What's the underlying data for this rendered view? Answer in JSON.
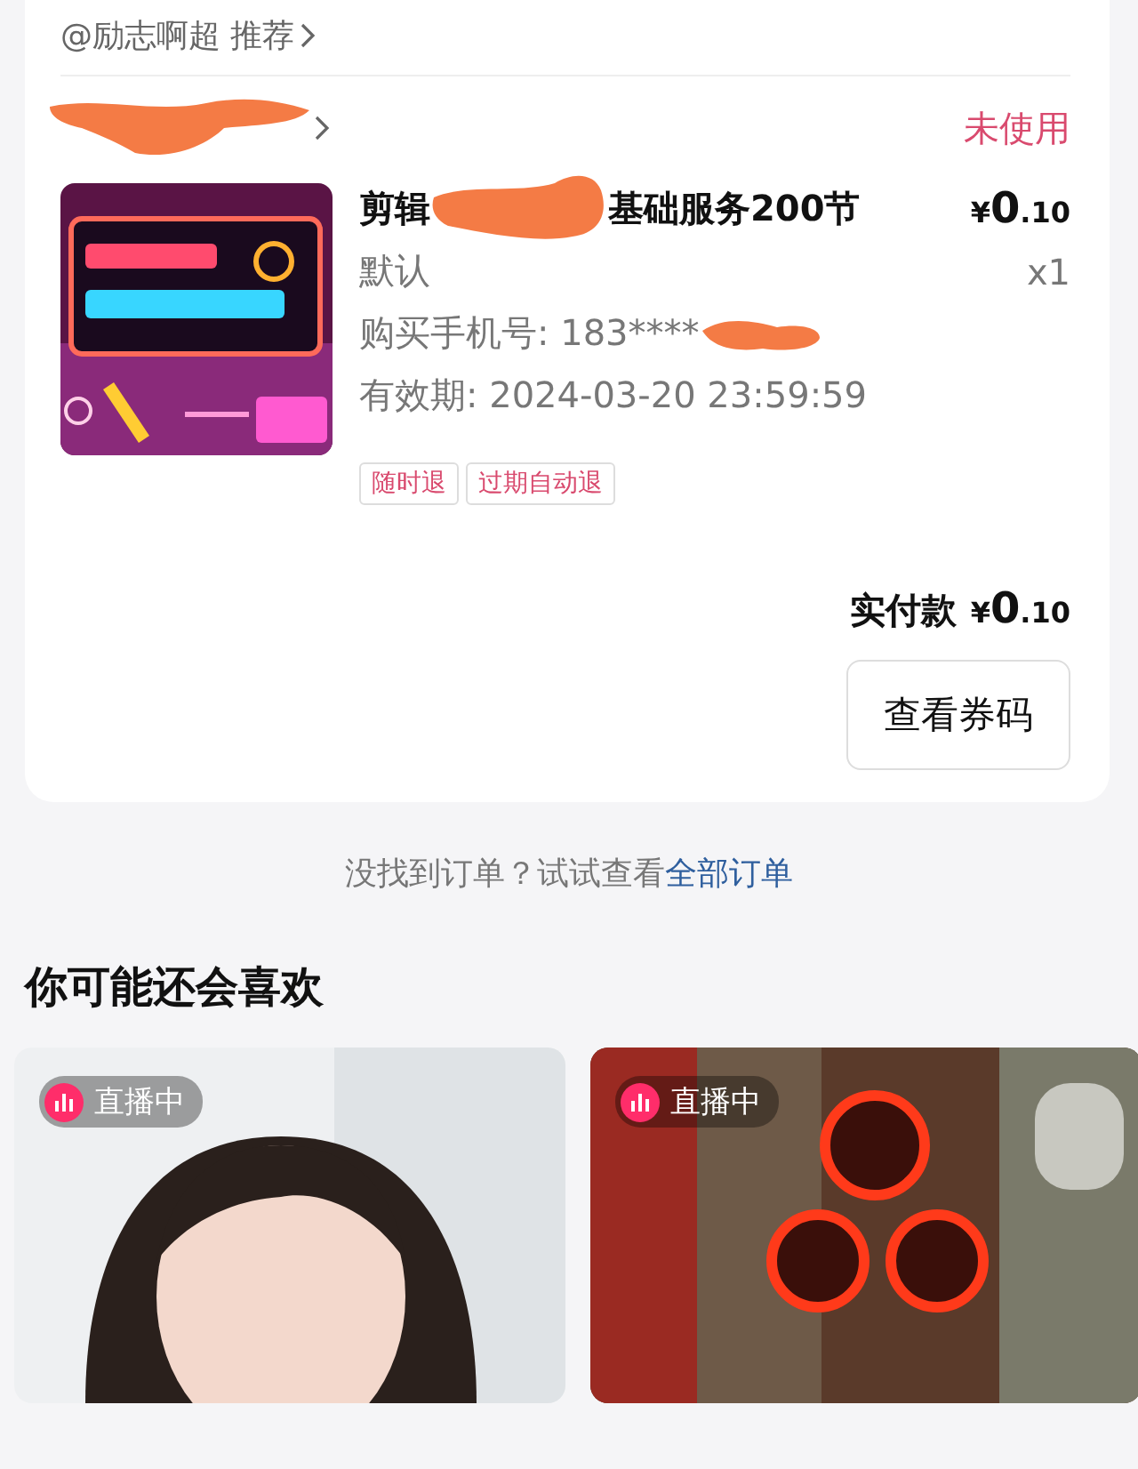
{
  "order": {
    "author": "@励志啊超",
    "recommend": "推荐",
    "status": "未使用",
    "product": {
      "kind": "picture",
      "title_start": "剪辑",
      "title_end": "基础服务200节",
      "price": {
        "symbol": "¥",
        "whole": "0",
        "fraction": ".10"
      },
      "spec": "默认",
      "quantity": "x1",
      "phone_label": "购买手机号: 183****",
      "validity": "有效期: 2024-03-20 23:59:59"
    },
    "tags": [
      "随时退",
      "过期自动退"
    ],
    "total": {
      "label": "实付款",
      "price": {
        "symbol": "¥",
        "whole": "0",
        "fraction": ".10"
      }
    },
    "button": "查看券码"
  },
  "hint": {
    "text": "没找到订单？试试查看",
    "link": "全部订单"
  },
  "recommendations": {
    "title": "你可能还会喜欢",
    "items": [
      {
        "kind": "portrait",
        "badge": "直播中"
      },
      {
        "kind": "rings",
        "badge": "直播中"
      }
    ]
  }
}
